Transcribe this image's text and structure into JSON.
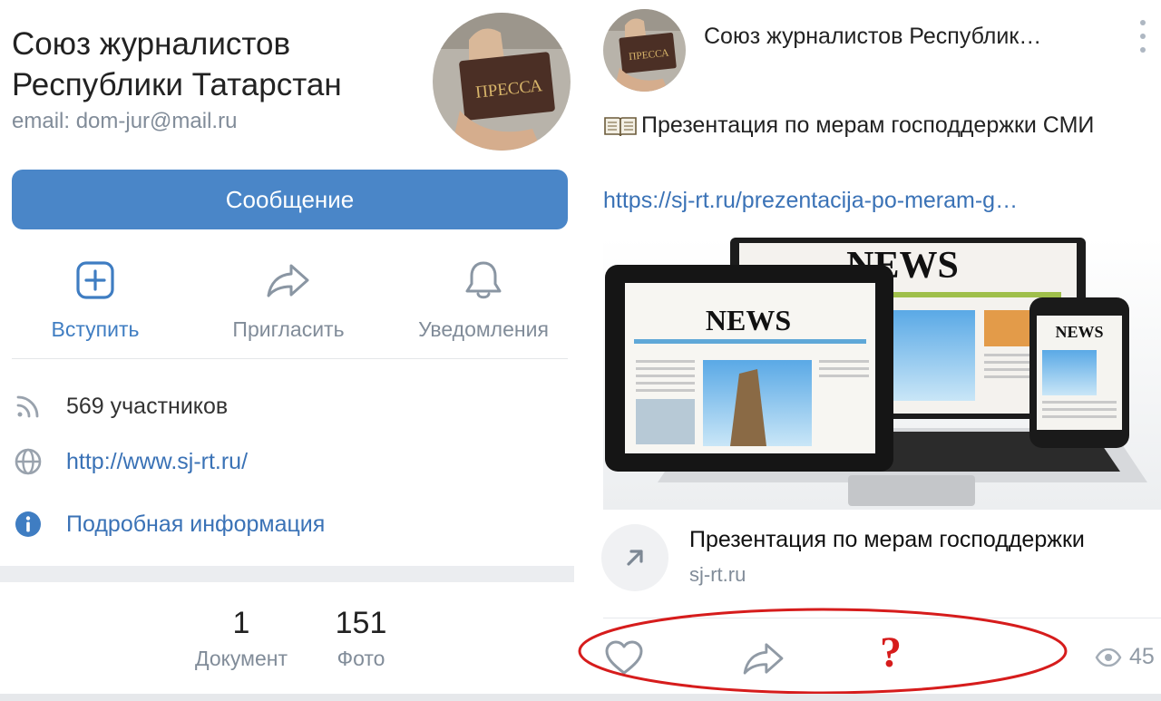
{
  "group": {
    "title": "Союз журналистов Республики Татарстан",
    "email": "email: dom-jur@mail.ru",
    "avatar_text": "ПРЕССА",
    "message_button": "Сообщение",
    "actions": [
      {
        "label": "Вступить",
        "icon": "plus-square-icon"
      },
      {
        "label": "Пригласить",
        "icon": "share-arrow-icon"
      },
      {
        "label": "Уведомления",
        "icon": "bell-icon"
      }
    ],
    "members": "569 участников",
    "website": "http://www.sj-rt.ru/",
    "details": "Подробная информация",
    "stats": [
      {
        "value": "1",
        "label": "Документ"
      },
      {
        "value": "151",
        "label": "Фото"
      }
    ]
  },
  "post": {
    "author": "Союз журналистов Республик…",
    "text": "Презентация по мерам господдержки СМИ",
    "link": "https://sj-rt.ru/prezentacija-po-meram-g…",
    "image_labels": [
      "NEWS",
      "NEWS",
      "NEWS"
    ],
    "snippet_title": "Презентация по мерам господдержки",
    "snippet_domain": "sj-rt.ru",
    "views": "45",
    "annotation": "?"
  },
  "colors": {
    "accent": "#4a86c8",
    "link": "#3a72b6",
    "secondary_text": "#818c99",
    "annotation_red": "#d61c1c"
  }
}
